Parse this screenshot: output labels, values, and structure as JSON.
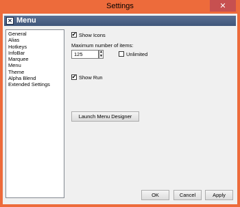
{
  "window": {
    "title": "Settings",
    "close_glyph": "✕"
  },
  "header": {
    "icon": "menu-app-icon",
    "icon_glyph": "✕",
    "title": "Menu"
  },
  "sidebar": {
    "items": [
      {
        "label": "General"
      },
      {
        "label": "Alias"
      },
      {
        "label": "Hotkeys"
      },
      {
        "label": "InfoBar"
      },
      {
        "label": "Marquee"
      },
      {
        "label": "Menu"
      },
      {
        "label": "Theme"
      },
      {
        "label": "Alpha Blend"
      },
      {
        "label": "Extended Settings"
      }
    ]
  },
  "content": {
    "show_icons": {
      "label": "Show Icons",
      "checked": true,
      "check_glyph": "✔"
    },
    "max_items": {
      "label": "Maximum number of items:",
      "value": "125",
      "up_glyph": "▲",
      "down_glyph": "▼"
    },
    "unlimited": {
      "label": "Unlimited",
      "checked": false
    },
    "show_run": {
      "label": "Show Run",
      "checked": true,
      "check_glyph": "✔"
    },
    "launch_button": "Launch Menu Designer"
  },
  "footer": {
    "ok": "OK",
    "cancel": "Cancel",
    "apply": "Apply"
  }
}
